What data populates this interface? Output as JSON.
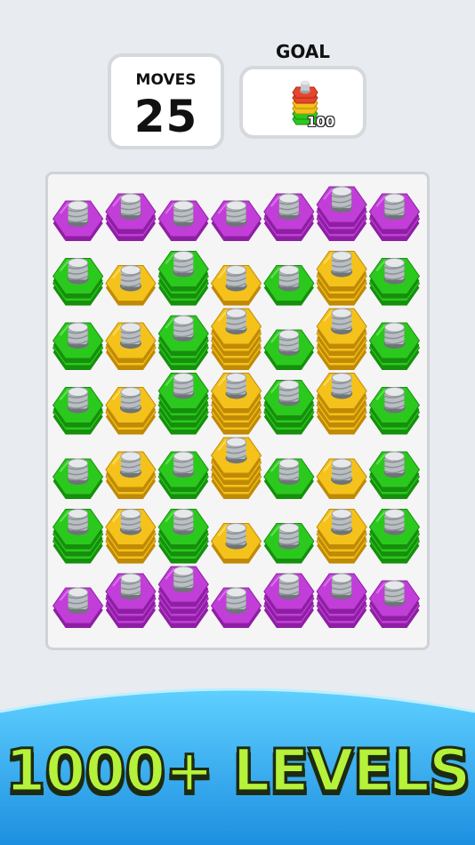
{
  "hud": {
    "moves_label": "MOVES",
    "moves_value": "25",
    "goal_label": "GOAL",
    "goal_count": "100"
  },
  "banner": {
    "text": "1000+ LEVELS"
  },
  "colors": {
    "purple": "#c23ed8",
    "green": "#2bc91d",
    "yellow": "#f4c21a",
    "background": "#e8ebef",
    "wave": "#2aa6ee",
    "banner_text": "#b6f23a"
  },
  "goal_icon": {
    "name": "nut-stack-icon",
    "layers": [
      "red",
      "yellow",
      "green"
    ]
  },
  "board": {
    "columns": 7,
    "rows": 7,
    "cells": [
      [
        {
          "c": "purple",
          "n": 1
        },
        {
          "c": "purple",
          "n": 2
        },
        {
          "c": "purple",
          "n": 1
        },
        {
          "c": "purple",
          "n": 1
        },
        {
          "c": "purple",
          "n": 2
        },
        {
          "c": "purple",
          "n": 3
        },
        {
          "c": "purple",
          "n": 2
        }
      ],
      [
        {
          "c": "green",
          "n": 2
        },
        {
          "c": "yellow",
          "n": 1
        },
        {
          "c": "green",
          "n": 3
        },
        {
          "c": "yellow",
          "n": 1
        },
        {
          "c": "green",
          "n": 1
        },
        {
          "c": "yellow",
          "n": 3
        },
        {
          "c": "green",
          "n": 2
        }
      ],
      [
        {
          "c": "green",
          "n": 2
        },
        {
          "c": "yellow",
          "n": 2
        },
        {
          "c": "green",
          "n": 3
        },
        {
          "c": "yellow",
          "n": 4
        },
        {
          "c": "green",
          "n": 1
        },
        {
          "c": "yellow",
          "n": 4
        },
        {
          "c": "green",
          "n": 2
        }
      ],
      [
        {
          "c": "green",
          "n": 2
        },
        {
          "c": "yellow",
          "n": 2
        },
        {
          "c": "green",
          "n": 4
        },
        {
          "c": "yellow",
          "n": 4
        },
        {
          "c": "green",
          "n": 3
        },
        {
          "c": "yellow",
          "n": 4
        },
        {
          "c": "green",
          "n": 2
        }
      ],
      [
        {
          "c": "green",
          "n": 1
        },
        {
          "c": "yellow",
          "n": 2
        },
        {
          "c": "green",
          "n": 2
        },
        {
          "c": "yellow",
          "n": 4
        },
        {
          "c": "green",
          "n": 1
        },
        {
          "c": "yellow",
          "n": 1
        },
        {
          "c": "green",
          "n": 2
        }
      ],
      [
        {
          "c": "green",
          "n": 3
        },
        {
          "c": "yellow",
          "n": 3
        },
        {
          "c": "green",
          "n": 3
        },
        {
          "c": "yellow",
          "n": 1
        },
        {
          "c": "green",
          "n": 1
        },
        {
          "c": "yellow",
          "n": 3
        },
        {
          "c": "green",
          "n": 3
        }
      ],
      [
        {
          "c": "purple",
          "n": 1
        },
        {
          "c": "purple",
          "n": 3
        },
        {
          "c": "purple",
          "n": 4
        },
        {
          "c": "purple",
          "n": 1
        },
        {
          "c": "purple",
          "n": 3
        },
        {
          "c": "purple",
          "n": 3
        },
        {
          "c": "purple",
          "n": 2
        }
      ]
    ]
  }
}
